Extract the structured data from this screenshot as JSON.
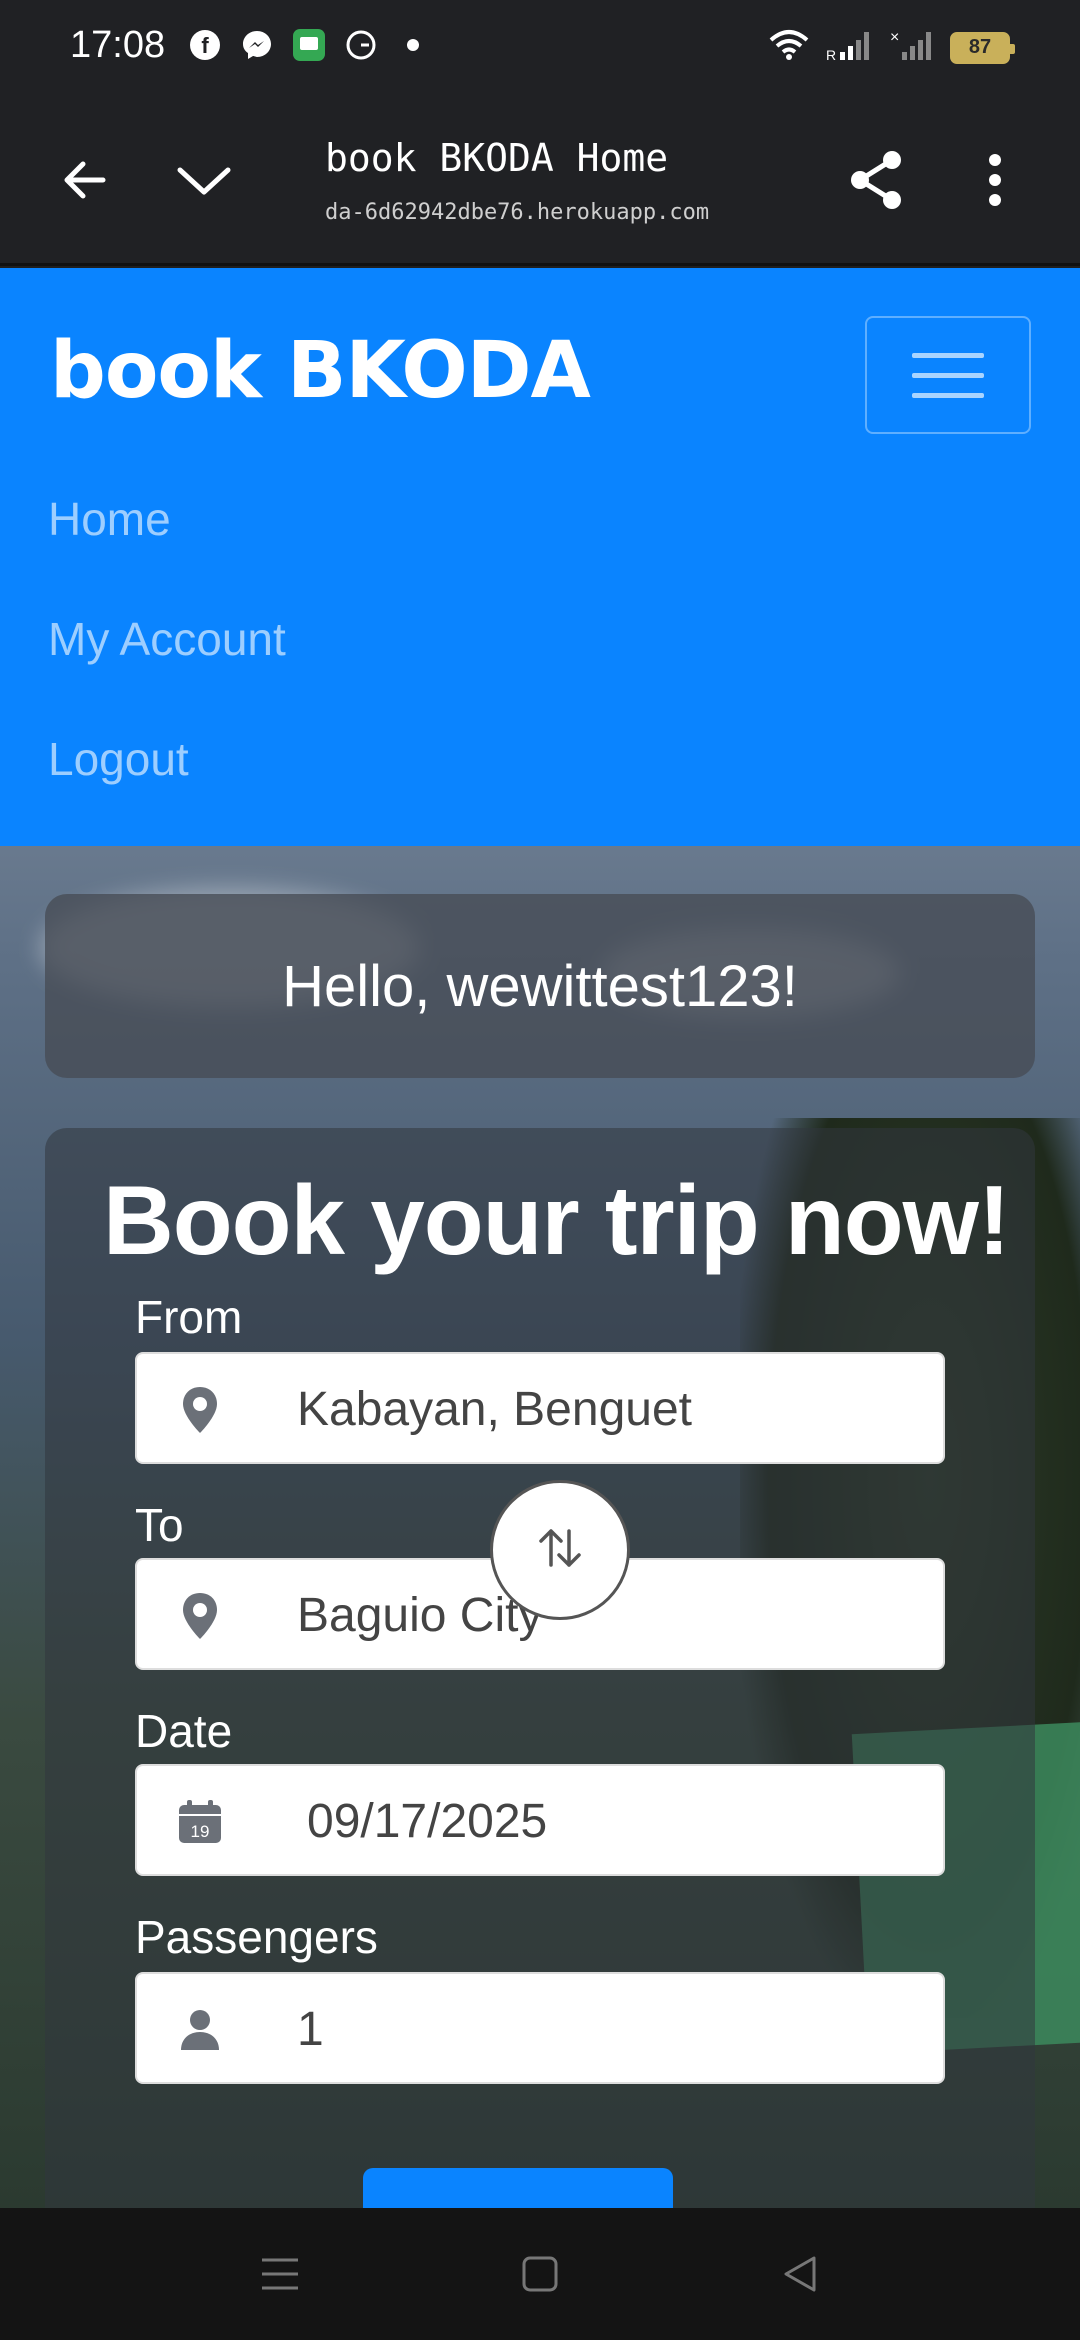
{
  "status_bar": {
    "time": "17:08",
    "apps": [
      "facebook-icon",
      "messenger-icon",
      "messages-icon",
      "grammarly-icon",
      "dot-icon"
    ],
    "battery": "87"
  },
  "browser": {
    "title": "book BKODA Home",
    "url": "da-6d62942dbe76.herokuapp.com"
  },
  "navbar": {
    "brand": "book BKODA",
    "links": [
      "Home",
      "My Account",
      "Logout"
    ]
  },
  "greeting": {
    "prefix": "Hello, ",
    "username": "wewittest123",
    "suffix": "!"
  },
  "booking": {
    "title": "Book your trip now!",
    "from_label": "From",
    "from_value": "Kabayan, Benguet",
    "to_label": "To",
    "to_value": "Baguio City",
    "date_label": "Date",
    "date_value": "09/17/2025",
    "date_icon_day": "19",
    "passengers_label": "Passengers",
    "passengers_value": "1"
  },
  "colors": {
    "accent": "#0a84ff",
    "status_bg": "#202124"
  }
}
